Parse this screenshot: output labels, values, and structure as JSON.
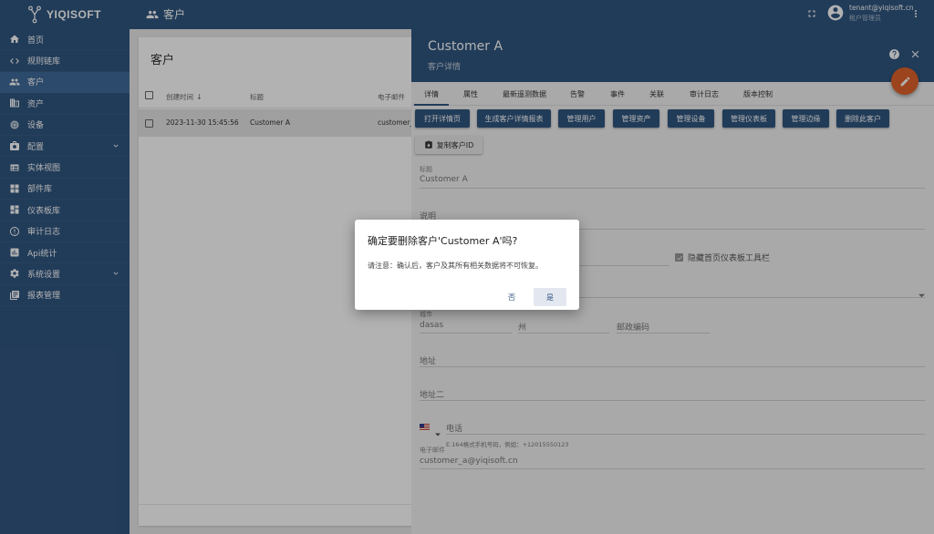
{
  "app": {
    "logo_text": "YIQISOFT"
  },
  "sidebar": {
    "items": [
      {
        "label": "首页",
        "icon": "home-icon"
      },
      {
        "label": "规则链库",
        "icon": "code-icon"
      },
      {
        "label": "客户",
        "icon": "users-icon",
        "active": true
      },
      {
        "label": "资产",
        "icon": "domain-icon"
      },
      {
        "label": "设备",
        "icon": "device-icon"
      },
      {
        "label": "配置",
        "icon": "settings-box-icon",
        "expandable": true
      },
      {
        "label": "实体视图",
        "icon": "view-icon"
      },
      {
        "label": "部件库",
        "icon": "widgets-icon"
      },
      {
        "label": "仪表板库",
        "icon": "dashboard-icon"
      },
      {
        "label": "审计日志",
        "icon": "audit-icon"
      },
      {
        "label": "Api统计",
        "icon": "bar-chart-icon"
      },
      {
        "label": "系统设置",
        "icon": "gear-icon",
        "expandable": true
      },
      {
        "label": "报表管理",
        "icon": "report-icon"
      }
    ]
  },
  "topbar": {
    "title": "客户",
    "user_email": "tenant@yiqisoft.cn",
    "user_role": "租户管理员"
  },
  "list": {
    "title": "客户",
    "columns": {
      "created": "创建时间",
      "title": "标题",
      "email": "电子邮件"
    },
    "rows": [
      {
        "created": "2023-11-30 15:45:56",
        "title": "Customer A",
        "email": "customer_"
      }
    ]
  },
  "details": {
    "title": "Customer A",
    "subtitle": "客户详情",
    "tabs": [
      "详情",
      "属性",
      "最新遥测数据",
      "告警",
      "事件",
      "关联",
      "审计日志",
      "版本控制"
    ],
    "buttons": [
      "打开详情页",
      "生成客户详情报表",
      "管理用户",
      "管理资产",
      "管理设备",
      "管理仪表板",
      "管理边缘",
      "删除此客户"
    ],
    "copy_id_label": "复制客户ID",
    "fields": {
      "title_label": "标题",
      "title_value": "Customer A",
      "description_placeholder": "说明",
      "hide_toolbar_label": "隐藏首页仪表板工具栏",
      "city_label": "城市",
      "city_value": "dasas",
      "state_placeholder": "州",
      "zip_placeholder": "邮政编码",
      "address_placeholder": "地址",
      "address2_placeholder": "地址二",
      "phone_placeholder": "电话",
      "phone_hint": "E.164格式手机号码，例如：+12015550123",
      "email_label": "电子邮件",
      "email_value": "customer_a@yiqisoft.cn"
    }
  },
  "dialog": {
    "title": "确定要删除客户'Customer A'吗?",
    "message": "请注意：确认后，客户及其所有相关数据将不可恢复。",
    "no_label": "否",
    "yes_label": "是"
  }
}
